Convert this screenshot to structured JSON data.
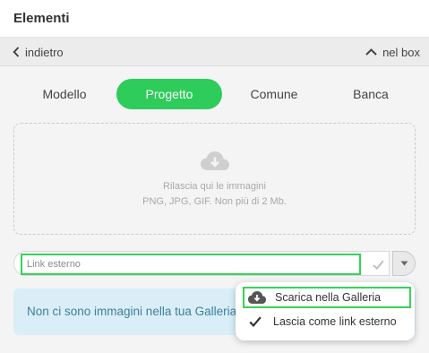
{
  "header": {
    "title": "Elementi"
  },
  "nav": {
    "back_label": "indietro",
    "box_label": "nel box"
  },
  "tabs": [
    {
      "label": "Modello",
      "active": false
    },
    {
      "label": "Progetto",
      "active": true
    },
    {
      "label": "Comune",
      "active": false
    },
    {
      "label": "Banca",
      "active": false
    }
  ],
  "dropzone": {
    "icon": "cloud-download-icon",
    "line1": "Rilascia qui le immagini",
    "line2": "PNG, JPG, GIF. Non più di 2 Mb."
  },
  "link": {
    "placeholder": "Link esterno",
    "value": ""
  },
  "notice": {
    "text": "Non ci sono immagini nella tua Galleria"
  },
  "dropdown": {
    "items": [
      {
        "label": "Scarica nella Galleria",
        "icon": "cloud-download-icon"
      },
      {
        "label": "Lascia come link esterno",
        "icon": "check-icon"
      }
    ]
  },
  "colors": {
    "accent": "#2ecc5a",
    "highlight_border": "#33d457",
    "notice_bg": "#d9eef6",
    "notice_text": "#3f7f9c"
  }
}
